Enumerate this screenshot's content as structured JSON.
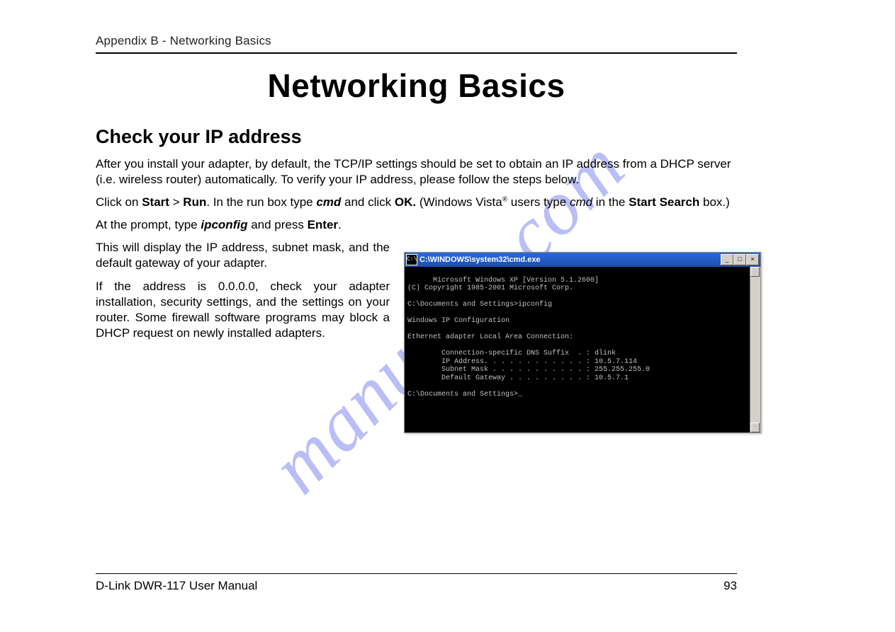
{
  "header": {
    "appendix": "Appendix B - Networking Basics",
    "title": "Networking Basics"
  },
  "section": {
    "subhead": "Check your IP address",
    "p1": "After you install your adapter, by default, the TCP/IP settings should be set to obtain an IP address from a DHCP server (i.e. wireless router) automatically. To verify your IP address, please follow the steps below.",
    "p2_1": "Click on ",
    "p2_start": "Start",
    "p2_gt": " > ",
    "p2_run": "Run",
    "p2_2": ". In the run box type ",
    "p2_cmd": "cmd",
    "p2_3": " and click ",
    "p2_ok": "OK.",
    "p2_4": " (Windows Vista",
    "p2_reg": "®",
    "p2_5": " users type ",
    "p2_cmd2": "cmd",
    "p2_6": " in the ",
    "p2_ss": "Start Search",
    "p2_7": " box.)",
    "p3_1": "At the prompt, type ",
    "p3_ip": "ipconfig",
    "p3_2": " and press ",
    "p3_enter": "Enter",
    "p3_3": ".",
    "p4": "This will display the IP address, subnet mask, and the default gateway of your adapter.",
    "p5": "If the address is 0.0.0.0, check your adapter installation, security settings, and the settings on your router. Some firewall software programs may block a DHCP request on newly installed adapters."
  },
  "cmd": {
    "title": "C:\\WINDOWS\\system32\\cmd.exe",
    "icon_glyph": "C:\\",
    "min": "_",
    "max": "□",
    "close": "×",
    "scroll_up": "▴",
    "scroll_down": "▾",
    "output": "Microsoft Windows XP [Version 5.1.2600]\n(C) Copyright 1985-2001 Microsoft Corp.\n\nC:\\Documents and Settings>ipconfig\n\nWindows IP Configuration\n\nEthernet adapter Local Area Connection:\n\n        Connection-specific DNS Suffix  . : dlink\n        IP Address. . . . . . . . . . . . : 10.5.7.114\n        Subnet Mask . . . . . . . . . . . : 255.255.255.0\n        Default Gateway . . . . . . . . . : 10.5.7.1\n\nC:\\Documents and Settings>_"
  },
  "footer": {
    "left": "D-Link DWR-117 User Manual",
    "page": "93"
  },
  "watermark": "manualzz.com"
}
